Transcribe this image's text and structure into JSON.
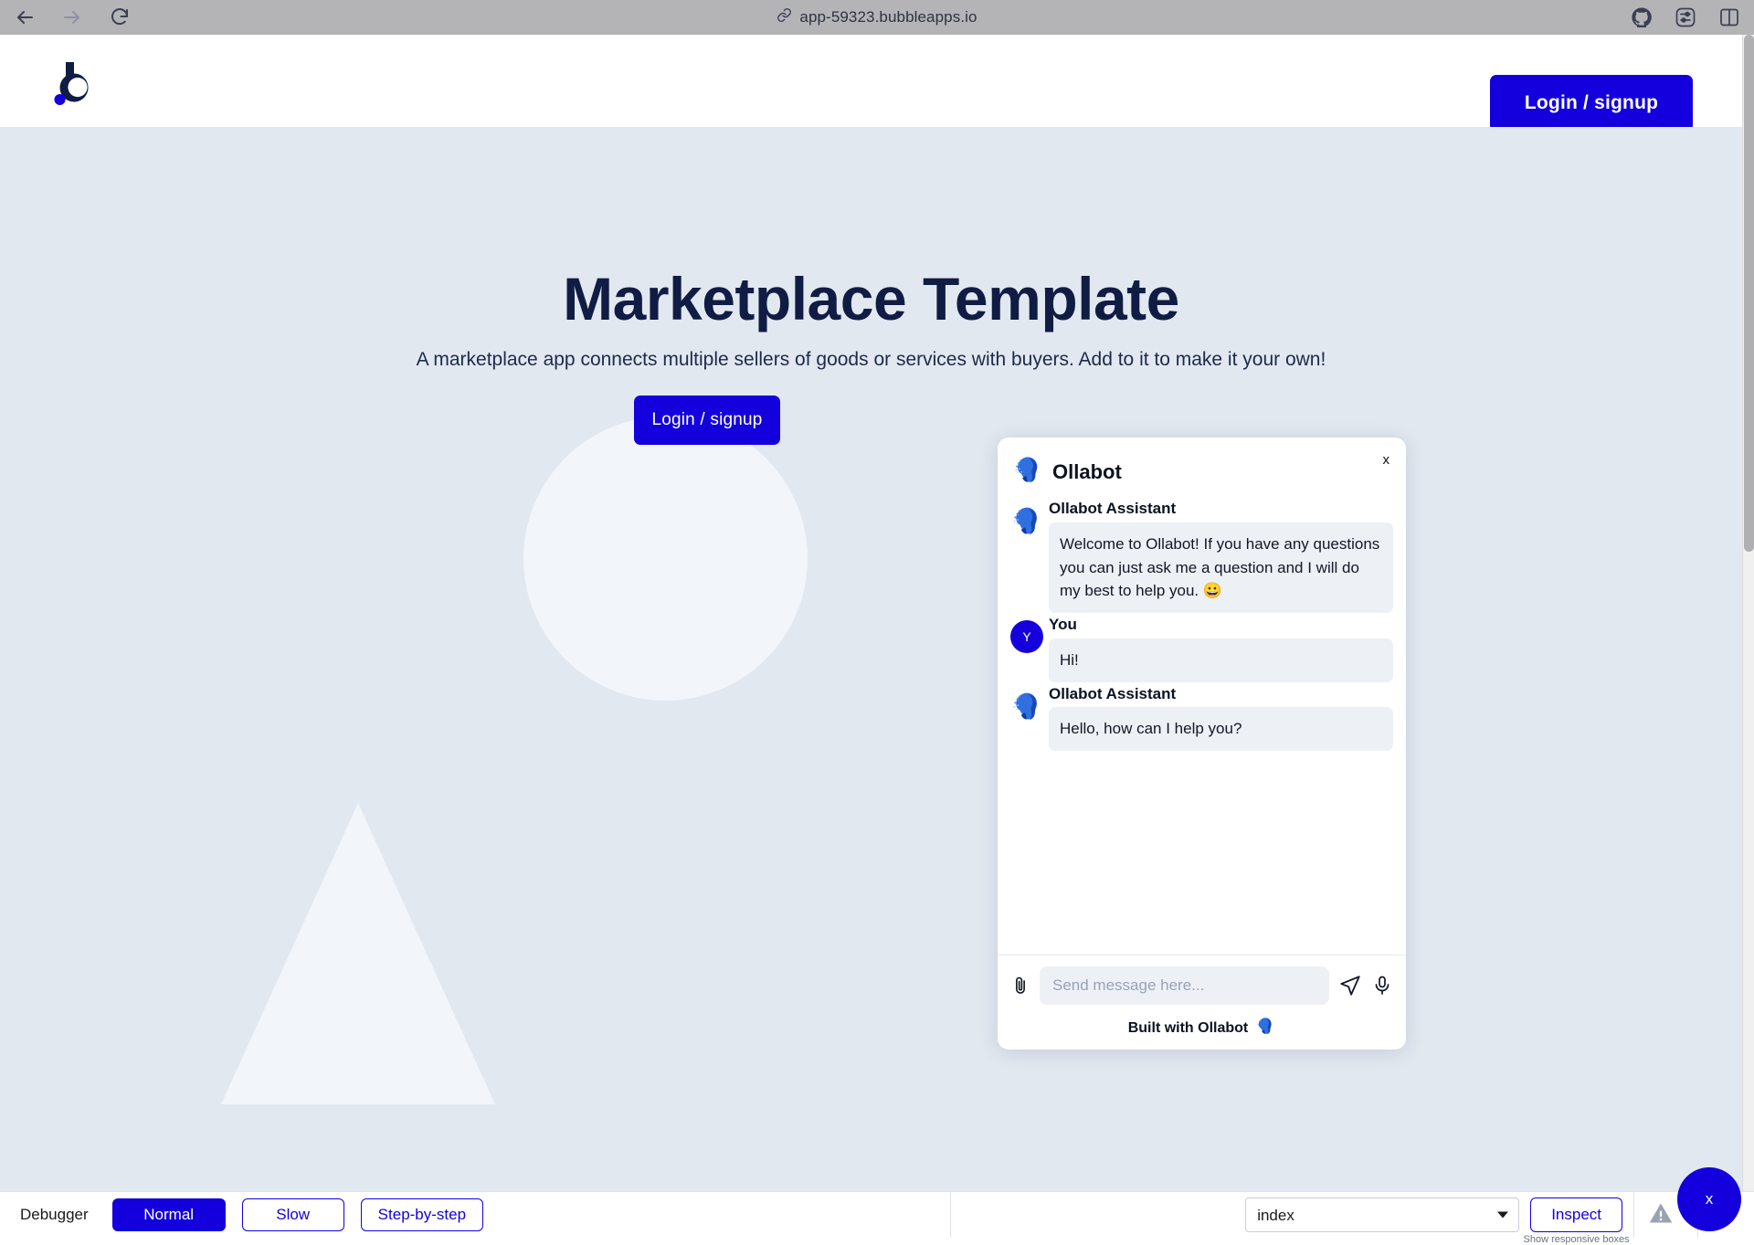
{
  "browser": {
    "url": "app-59323.bubbleapps.io",
    "nav": {
      "back_label": "Back",
      "forward_label": "Forward",
      "reload_label": "Reload"
    },
    "right_icons": [
      {
        "name": "github-icon",
        "label": "GitHub"
      },
      {
        "name": "sliders-icon",
        "label": "Settings"
      },
      {
        "name": "split-panel-icon",
        "label": "Split view"
      }
    ]
  },
  "site": {
    "logo_alt": "Bubble logo",
    "header_login_label": "Login / signup"
  },
  "hero": {
    "title": "Marketplace Template",
    "subtitle": "A marketplace app connects multiple sellers of goods or services with buyers. Add to it to make it your own!",
    "cta_label": "Login / signup"
  },
  "chat": {
    "title": "Ollabot",
    "close_label": "x",
    "messages": [
      {
        "author": "Ollabot Assistant",
        "avatar": "ollabot-avatar",
        "text": "Welcome to Ollabot! If you have any questions you can just ask me a question and I will do my best to help you. 😀"
      },
      {
        "author": "You",
        "avatar": "user-avatar",
        "avatar_initial": "Y",
        "text": "Hi!"
      },
      {
        "author": "Ollabot Assistant",
        "avatar": "ollabot-avatar",
        "text": "Hello, how can I help you?"
      }
    ],
    "input_placeholder": "Send message here...",
    "input_value": "",
    "attach_label": "Attach file",
    "send_label": "Send",
    "mic_label": "Voice input",
    "footer_text": "Built with Ollabot"
  },
  "fab": {
    "label": "x"
  },
  "debugger": {
    "label": "Debugger",
    "modes": [
      {
        "label": "Normal",
        "active": true
      },
      {
        "label": "Slow",
        "active": false
      },
      {
        "label": "Step-by-step",
        "active": false
      }
    ],
    "page_select_value": "index",
    "page_select_options": [
      "index"
    ],
    "inspect_label": "Inspect",
    "responsive_hint": "Show responsive boxes",
    "warning_icon": "warning-triangle-icon",
    "menu_icon": "kebab-menu-icon"
  },
  "colors": {
    "accent_blue": "#1300dd",
    "hero_bg": "#e1e8f0",
    "deco_shape": "#f2f5f9",
    "title_navy": "#111c44",
    "bubble_grey": "#edf1f6",
    "chrome_grey": "#b4b4b6"
  }
}
